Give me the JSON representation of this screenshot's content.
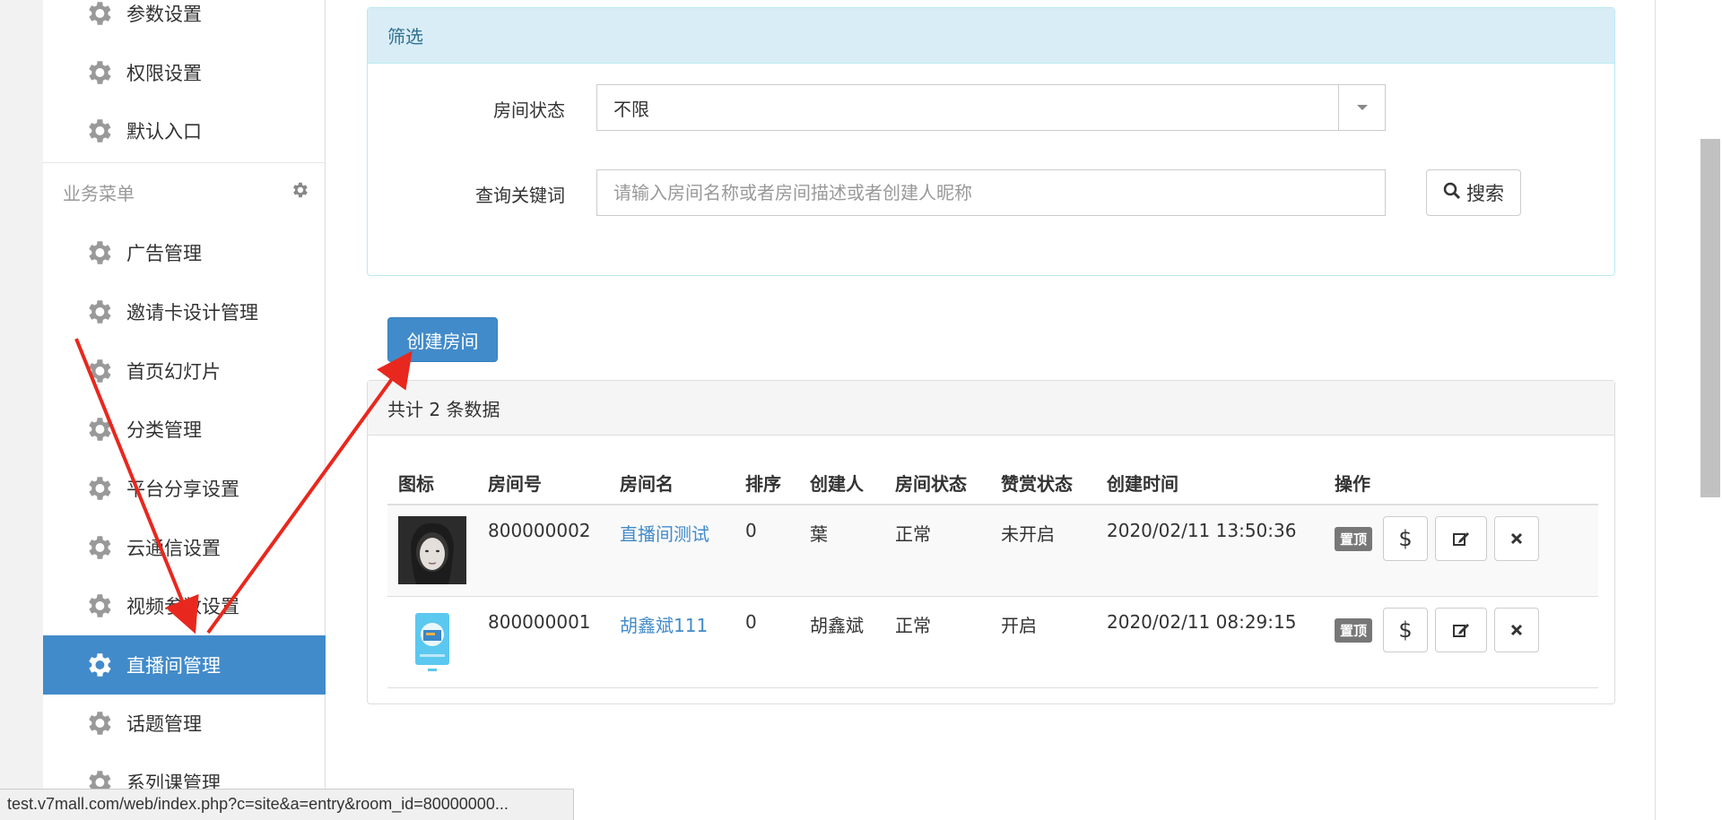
{
  "sidebar": {
    "top_items": [
      {
        "label": "参数设置"
      },
      {
        "label": "权限设置"
      },
      {
        "label": "默认入口"
      }
    ],
    "section_title": "业务菜单",
    "items": [
      {
        "label": "广告管理"
      },
      {
        "label": "邀请卡设计管理"
      },
      {
        "label": "首页幻灯片"
      },
      {
        "label": "分类管理"
      },
      {
        "label": "平台分享设置"
      },
      {
        "label": "云通信设置"
      },
      {
        "label": "视频参数设置"
      },
      {
        "label": "直播间管理",
        "active": true
      },
      {
        "label": "话题管理"
      },
      {
        "label": "系列课管理"
      }
    ]
  },
  "filter": {
    "title": "筛选",
    "status_label": "房间状态",
    "status_value": "不限",
    "keyword_label": "查询关键词",
    "keyword_placeholder": "请输入房间名称或者房间描述或者创建人昵称",
    "search_button": "搜索"
  },
  "create_button": "创建房间",
  "list": {
    "summary": "共计 2 条数据",
    "columns": [
      "图标",
      "房间号",
      "房间名",
      "排序",
      "创建人",
      "房间状态",
      "赞赏状态",
      "创建时间",
      "操作"
    ],
    "rows": [
      {
        "room_id": "800000002",
        "room_name": "直播间测试",
        "order": "0",
        "creator": "葉",
        "room_status": "正常",
        "reward_status": "未开启",
        "created": "2020/02/11 13:50:36",
        "tag": "置顶"
      },
      {
        "room_id": "800000001",
        "room_name": "胡鑫斌111",
        "order": "0",
        "creator": "胡鑫斌",
        "room_status": "正常",
        "reward_status": "开启",
        "created": "2020/02/11 08:29:15",
        "tag": "置顶"
      }
    ]
  },
  "status_bar": "test.v7mall.com/web/index.php?c=site&a=entry&room_id=80000000...",
  "colors": {
    "primary": "#428bca",
    "annotation": "#e8281e"
  }
}
